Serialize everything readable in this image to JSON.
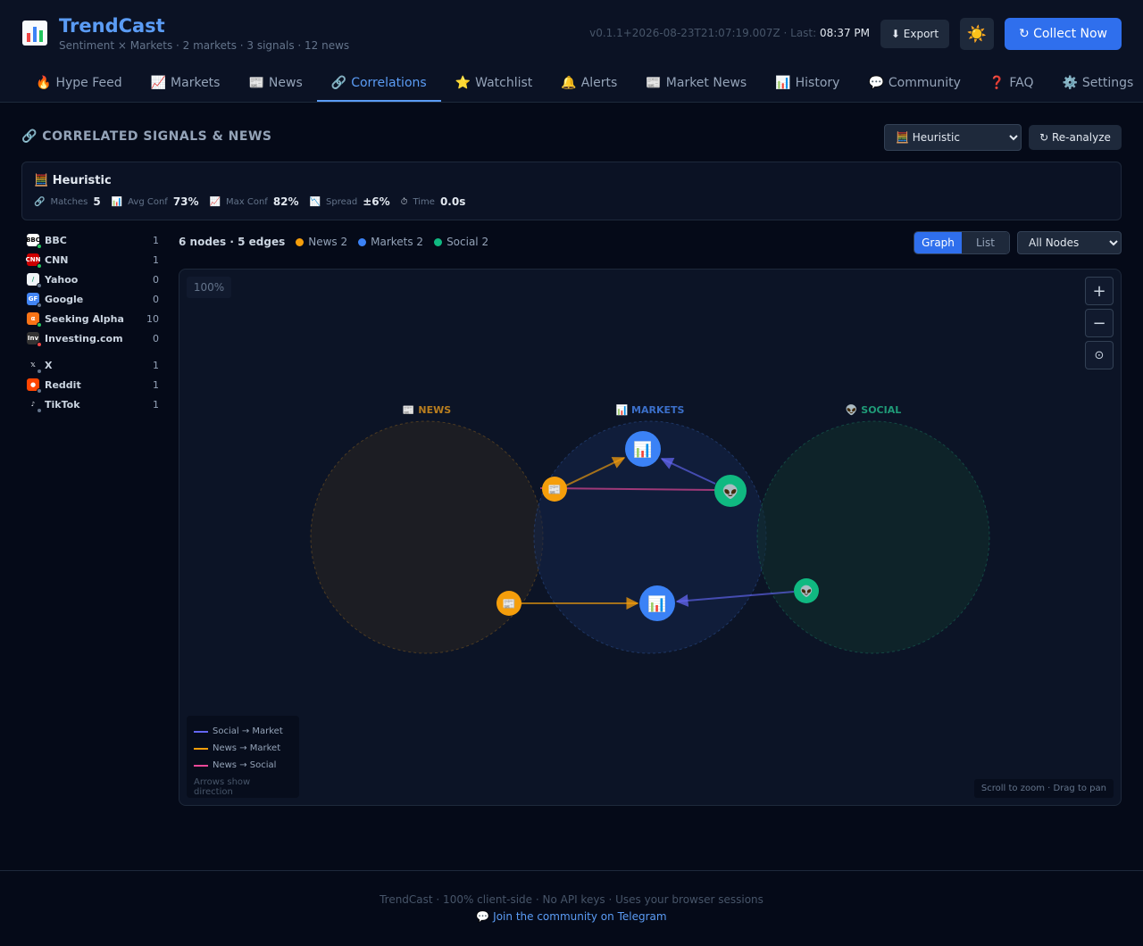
{
  "app": {
    "name": "TrendCast",
    "subtitle": "Sentiment × Markets · 2 markets · 3 signals · 12 news",
    "version_text": "v0.1.1+2026-08-23T21:07:19.007Z · Last: ",
    "last_time": "08:37 PM",
    "export_label": "⬇ Export",
    "theme_icon": "☀️",
    "collect_label": "↻ Collect Now"
  },
  "tabs": [
    {
      "icon": "🔥",
      "label": "Hype Feed",
      "active": false
    },
    {
      "icon": "📈",
      "label": "Markets",
      "active": false
    },
    {
      "icon": "📰",
      "label": "News",
      "active": false
    },
    {
      "icon": "🔗",
      "label": "Correlations",
      "active": true
    },
    {
      "icon": "⭐",
      "label": "Watchlist",
      "active": false
    },
    {
      "icon": "🔔",
      "label": "Alerts",
      "active": false
    },
    {
      "icon": "📰",
      "label": "Market News",
      "active": false
    },
    {
      "icon": "📊",
      "label": "History",
      "active": false
    },
    {
      "icon": "💬",
      "label": "Community",
      "active": false
    },
    {
      "icon": "❓",
      "label": "FAQ",
      "active": false
    },
    {
      "icon": "⚙️",
      "label": "Settings",
      "active": false
    }
  ],
  "section": {
    "title": "🔗 CORRELATED SIGNALS & NEWS",
    "algorithm_selected": "🧮 Heuristic",
    "reanalyze_label": "↻ Re-analyze"
  },
  "stats": {
    "title": "🧮 Heuristic",
    "items": [
      {
        "icon": "🔗",
        "label": "Matches",
        "value": "5"
      },
      {
        "icon": "📊",
        "label": "Avg Conf",
        "value": "73%"
      },
      {
        "icon": "📈",
        "label": "Max Conf",
        "value": "82%"
      },
      {
        "icon": "📉",
        "label": "Spread",
        "value": "±6%"
      },
      {
        "icon": "⏱",
        "label": "Time",
        "value": "0.0s"
      }
    ]
  },
  "sources_news": [
    {
      "name": "BBC",
      "count": "1",
      "color": "#ffffff",
      "text_color": "#000000",
      "glyph": "BBC",
      "status": "#22c55e"
    },
    {
      "name": "CNN",
      "count": "1",
      "color": "#cc0000",
      "text_color": "#ffffff",
      "glyph": "CNN",
      "status": "#22c55e"
    },
    {
      "name": "Yahoo",
      "count": "0",
      "color": "#f1f5f9",
      "text_color": "#1d9a6c",
      "glyph": "/",
      "status": "#64748b"
    },
    {
      "name": "Google",
      "count": "0",
      "color": "#4285f4",
      "text_color": "#ffffff",
      "glyph": "GF",
      "status": "#64748b"
    },
    {
      "name": "Seeking Alpha",
      "count": "10",
      "color": "#f97316",
      "text_color": "#ffffff",
      "glyph": "α",
      "status": "#22c55e"
    },
    {
      "name": "Investing.com",
      "count": "0",
      "color": "#333333",
      "text_color": "#ffffff",
      "glyph": "Inv",
      "status": "#ef4444"
    }
  ],
  "sources_social": [
    {
      "name": "X",
      "count": "1",
      "color": "#050a18",
      "text_color": "#e2e8f0",
      "glyph": "𝕏",
      "status": "#64748b"
    },
    {
      "name": "Reddit",
      "count": "1",
      "color": "#ff4500",
      "text_color": "#ffffff",
      "glyph": "●",
      "status": "#64748b"
    },
    {
      "name": "TikTok",
      "count": "1",
      "color": "#050a18",
      "text_color": "#e2e8f0",
      "glyph": "♪",
      "status": "#64748b"
    }
  ],
  "graph_header": {
    "summary": "6 nodes · 5 edges",
    "legend": [
      {
        "label": "News 2",
        "color": "#f59e0b"
      },
      {
        "label": "Markets 2",
        "color": "#3b82f6"
      },
      {
        "label": "Social 2",
        "color": "#10b981"
      }
    ],
    "view_graph": "Graph",
    "view_list": "List",
    "node_filter": "All Nodes"
  },
  "graph": {
    "zoom": "100%",
    "zoom_in": "+",
    "zoom_out": "−",
    "reset": "⊙",
    "clusters": [
      {
        "id": "news",
        "label": "📰 NEWS",
        "color": "#b97e1f"
      },
      {
        "id": "markets",
        "label": "📊 MARKETS",
        "color": "#3b6fc9"
      },
      {
        "id": "social",
        "label": "👽 SOCIAL",
        "color": "#1f9b78"
      }
    ],
    "node_icons": {
      "news": "📰",
      "market": "📊",
      "social": "👽"
    },
    "colors": {
      "news": "#f59e0b",
      "market": "#3b82f6",
      "social": "#10b981",
      "edge_social_market": "#6366f1",
      "edge_news_market": "#f59e0b",
      "edge_news_social": "#ec4899"
    },
    "edge_legend": [
      {
        "label": "Social → Market",
        "color": "#6366f1"
      },
      {
        "label": "News → Market",
        "color": "#f59e0b"
      },
      {
        "label": "News → Social",
        "color": "#ec4899"
      }
    ],
    "edge_note": "Arrows show direction",
    "hint": "Scroll to zoom · Drag to pan"
  },
  "footer": {
    "line1": "TrendCast · 100% client-side · No API keys · Uses your browser sessions",
    "line2": "💬 Join the community on Telegram"
  }
}
